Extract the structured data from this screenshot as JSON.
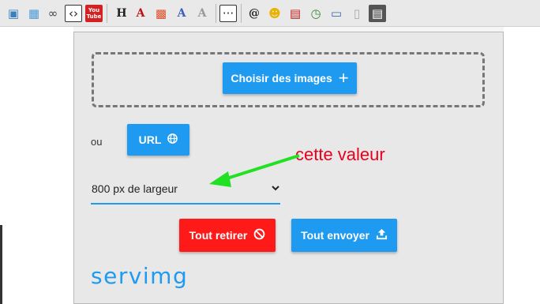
{
  "toolbar": {
    "items": [
      {
        "icon": "save-icon",
        "glyph": "▣",
        "color": "#3a7fc0"
      },
      {
        "icon": "image-icon",
        "glyph": "▦",
        "color": "#4a9ad8"
      },
      {
        "icon": "link-icon",
        "glyph": "∞",
        "color": "#444"
      },
      {
        "icon": "code-icon",
        "glyph": "‹›",
        "color": "#222"
      },
      {
        "icon": "youtube-icon",
        "glyph": "You\nTube",
        "color": "#fff"
      },
      {
        "icon": "heading-icon",
        "glyph": "H",
        "color": "#222"
      },
      {
        "icon": "font-color-icon",
        "glyph": "A",
        "color": "#c01010"
      },
      {
        "icon": "colors-icon",
        "glyph": "▩",
        "color": "#e0502a"
      },
      {
        "icon": "font-face-icon",
        "glyph": "A",
        "color": "#3a60c0"
      },
      {
        "icon": "font-size-icon",
        "glyph": "A",
        "color": "#999"
      },
      {
        "icon": "more-icon",
        "glyph": "···",
        "color": "#222"
      },
      {
        "icon": "mention-icon",
        "glyph": "@",
        "color": "#222"
      },
      {
        "icon": "emoji-icon",
        "glyph": "☻",
        "color": "#e8b400"
      },
      {
        "icon": "calendar-icon",
        "glyph": "▤",
        "color": "#c02020"
      },
      {
        "icon": "clock-icon",
        "glyph": "◷",
        "color": "#3a8a3a"
      },
      {
        "icon": "screen-icon",
        "glyph": "▭",
        "color": "#3a6ab0"
      },
      {
        "icon": "clipboard-icon",
        "glyph": "▯",
        "color": "#aaa"
      },
      {
        "icon": "document-icon",
        "glyph": "▤",
        "color": "#fff"
      }
    ]
  },
  "dialog": {
    "choose_label": "Choisir des images",
    "or_label": "ou",
    "url_label": "URL",
    "width_value": "800 px de largeur",
    "remove_label": "Tout retirer",
    "send_label": "Tout envoyer",
    "brand": "servimg"
  },
  "annotation": {
    "text": "cette valeur",
    "text_color": "#e8001c",
    "arrow_color": "#22e022"
  },
  "colors": {
    "primary": "#1e9bf0",
    "danger": "#ff1a1a"
  }
}
